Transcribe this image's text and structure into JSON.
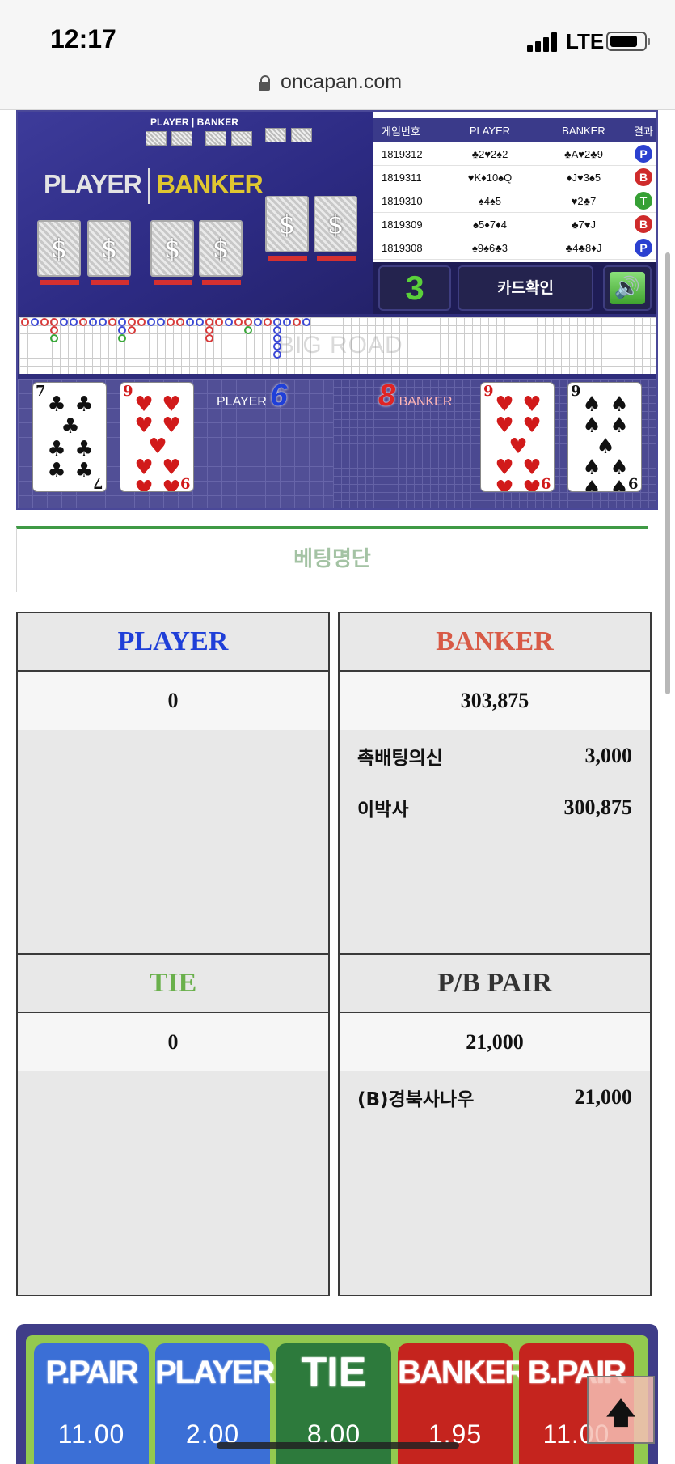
{
  "status": {
    "time": "12:17",
    "network": "LTE"
  },
  "browser": {
    "url": "oncapan.com"
  },
  "video": {
    "small_title_player": "PLAYER",
    "small_title_banker": "BANKER",
    "title_player": "PLAYER",
    "title_banker": "BANKER"
  },
  "history": {
    "headers": [
      "게임번호",
      "PLAYER",
      "BANKER",
      "결과"
    ],
    "rows": [
      {
        "id": "1819312",
        "player": "♣2♥2♠2",
        "banker": "♣A♥2♣9",
        "result": "P"
      },
      {
        "id": "1819311",
        "player": "♥K♦10♠Q",
        "banker": "♦J♥3♠5",
        "result": "B"
      },
      {
        "id": "1819310",
        "player": "♠4♠5",
        "banker": "♥2♣7",
        "result": "T"
      },
      {
        "id": "1819309",
        "player": "♠5♦7♦4",
        "banker": "♣7♥J",
        "result": "B"
      },
      {
        "id": "1819308",
        "player": "♠9♠6♣3",
        "banker": "♣4♣8♦J",
        "result": "P"
      }
    ]
  },
  "controls": {
    "count": "3",
    "confirm_label": "카드확인",
    "sound_icon": "speaker-icon"
  },
  "bigroad": {
    "watermark": "BIG ROAD"
  },
  "current_hand": {
    "player_label": "PLAYER",
    "player_score": "6",
    "banker_label": "BANKER",
    "banker_score": "8",
    "player_cards": [
      {
        "rank": "7",
        "suit": "♣",
        "color": "black"
      },
      {
        "rank": "9",
        "suit": "♥",
        "color": "red"
      }
    ],
    "banker_cards": [
      {
        "rank": "9",
        "suit": "♥",
        "color": "red"
      },
      {
        "rank": "9",
        "suit": "♠",
        "color": "black"
      }
    ]
  },
  "bet_list": {
    "title": "베팅명단",
    "panels": {
      "player": {
        "header": "PLAYER",
        "total": "0",
        "entries": []
      },
      "banker": {
        "header": "BANKER",
        "total": "303,875",
        "entries": [
          {
            "name": "촉배팅의신",
            "amount": "3,000"
          },
          {
            "name": "이박사",
            "amount": "300,875"
          }
        ]
      },
      "tie": {
        "header": "TIE",
        "total": "0",
        "entries": []
      },
      "pair": {
        "header": "P/B PAIR",
        "total": "21,000",
        "entries": [
          {
            "name": "(B)경북사나우",
            "amount": "21,000"
          }
        ]
      }
    },
    "colors": {
      "player": "#1f3fd8",
      "banker": "#d85a46",
      "tie": "#6ab04c",
      "pair": "#333333"
    }
  },
  "bet_buttons": [
    {
      "label": "P.PAIR",
      "odds": "11.00",
      "color": "blue"
    },
    {
      "label": "PLAYER",
      "odds": "2.00",
      "color": "blue"
    },
    {
      "label": "TIE",
      "odds": "8.00",
      "color": "green"
    },
    {
      "label": "BANKER",
      "odds": "1.95",
      "color": "red"
    },
    {
      "label": "B.PAIR",
      "odds": "11.00",
      "color": "red"
    }
  ],
  "scroll_top_icon": "arrow-up-icon"
}
